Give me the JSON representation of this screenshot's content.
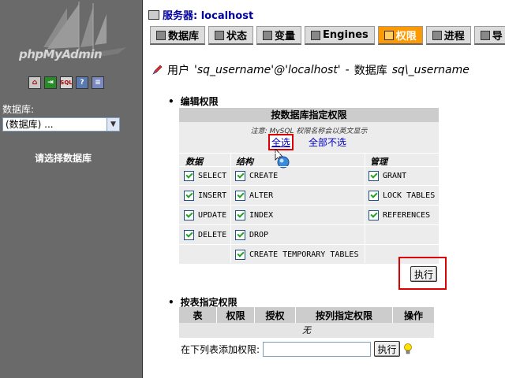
{
  "nav": {
    "logo_text": "phpMyAdmin",
    "icons": [
      "home-icon",
      "exit-icon",
      "sql-icon",
      "help-icon",
      "docs-icon"
    ],
    "db_label": "数据库:",
    "db_select_value": "(数据库) ...",
    "choose_db": "请选择数据库"
  },
  "server": {
    "label": "服务器: localhost"
  },
  "tabs": [
    {
      "label": "数据库",
      "active": false
    },
    {
      "label": "状态",
      "active": false
    },
    {
      "label": "变量",
      "active": false
    },
    {
      "label": "Engines",
      "active": false
    },
    {
      "label": "权限",
      "active": true
    },
    {
      "label": "进程",
      "active": false
    },
    {
      "label": "导",
      "active": false
    }
  ],
  "heading": {
    "user_label": "用户",
    "user_value": "'sq_username'@'localhost'",
    "sep": "-",
    "db_label": "数据库",
    "db_value": "sq\\_username"
  },
  "edit": {
    "section_label": "编辑权限",
    "table_title": "按数据库指定权限",
    "note": "注意: MySQL 权限名称会以英文显示",
    "select_all": "全选",
    "deselect_all": "全部不选",
    "col_data": "数据",
    "col_structure": "结构",
    "col_admin": "管理",
    "data_privs": [
      "SELECT",
      "INSERT",
      "UPDATE",
      "DELETE"
    ],
    "structure_privs": [
      "CREATE",
      "ALTER",
      "INDEX",
      "DROP",
      "CREATE TEMPORARY TABLES"
    ],
    "admin_privs": [
      "GRANT",
      "LOCK TABLES",
      "REFERENCES"
    ],
    "go_label": "执行"
  },
  "table_privs": {
    "section_label": "按表指定权限",
    "headers": [
      "表",
      "权限",
      "授权",
      "按列指定权限",
      "操作"
    ],
    "none": "无",
    "add_label": "在下列表添加权限:",
    "go_label": "执行"
  }
}
